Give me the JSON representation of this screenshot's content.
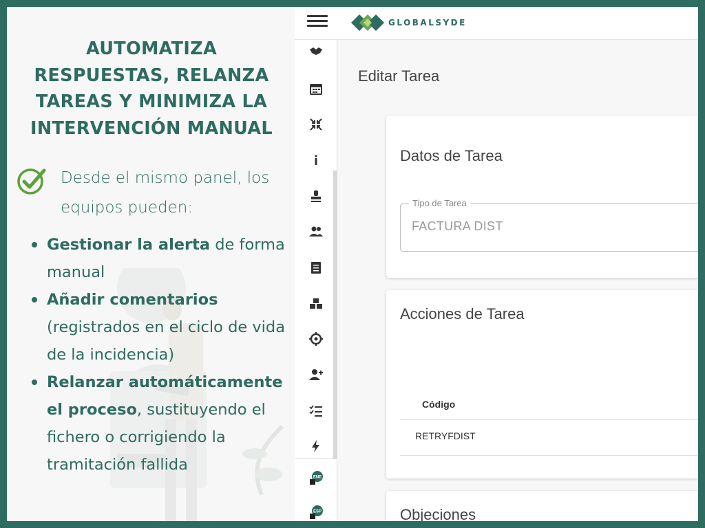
{
  "headline": "AUTOMATIZA RESPUESTAS, RELANZA TAREAS Y MINIMIZA LA INTERVENCIÓN MANUAL",
  "intro": "Desde el mismo panel, los equipos pueden:",
  "bullets": [
    {
      "bold": "Gestionar la alerta",
      "rest": " de forma manual"
    },
    {
      "bold": "Añadir comentarios",
      "rest": " (registrados en el ciclo de vida de la incidencia)"
    },
    {
      "bold": "Relanzar automáticamente el proceso",
      "rest": ", sustituyendo el fichero o corrigiendo la tramitación fallida"
    }
  ],
  "app": {
    "logo_text": "GLOBALSYDE",
    "page_title": "Editar Tarea",
    "datos": {
      "title": "Datos de Tarea",
      "field_label": "Tipo de Tarea",
      "field_value": "FACTURA DIST"
    },
    "acciones": {
      "title": "Acciones de Tarea",
      "col_codigo": "Código",
      "row_codigo": "RETRYFDIST"
    },
    "objeciones_title": "Objeciones",
    "lang_badges": [
      "ENE",
      "ESP"
    ]
  },
  "colors": {
    "brand": "#2e6b61",
    "frame": "#2e6b61"
  },
  "rail_icons": [
    "handshake-icon",
    "calendar-icon",
    "collapse-arrows-icon",
    "info-icon",
    "stamp-icon",
    "group-icon",
    "document-icon",
    "boxes-icon",
    "target-icon",
    "add-user-icon",
    "checklist-icon",
    "lightning-icon"
  ]
}
